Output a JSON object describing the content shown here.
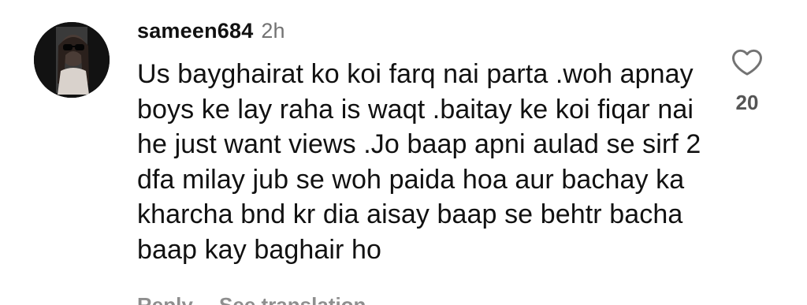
{
  "comment": {
    "username": "sameen684",
    "time": "2h",
    "text": "Us bayghairat ko koi farq nai parta .woh apnay boys ke lay raha is waqt .baitay ke koi fiqar nai he just want views .Jo baap apni aulad se sirf 2 dfa milay jub se woh paida hoa aur bachay ka kharcha bnd kr dia aisay baap se behtr bacha baap kay baghair ho",
    "likes": "20",
    "like_icon": "heart-outline-icon"
  },
  "actions": {
    "reply_label": "Reply",
    "translation_label": "See translation"
  }
}
